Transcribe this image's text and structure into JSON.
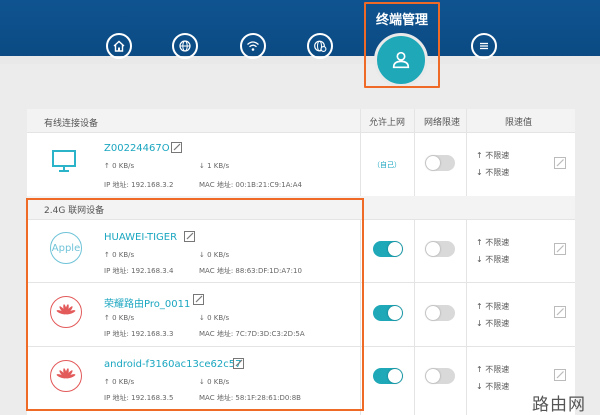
{
  "nav": {
    "active_label": "终端管理",
    "icons": [
      "home-icon",
      "globe-icon",
      "wifi-icon",
      "globe-settings-icon",
      "user-icon",
      "menu-icon"
    ]
  },
  "columns": {
    "allow_internet": "允许上网",
    "speed_limit": "网络限速",
    "limit_value": "限速值"
  },
  "wired": {
    "title": "有线连接设备",
    "devices": [
      {
        "name": "Z00224467O",
        "up": "0 KB/s",
        "down": "1 KB/s",
        "ip_label": "IP 地址:",
        "ip": "192.168.3.2",
        "mac_label": "MAC 地址:",
        "mac": "00:1B:21:C9:1A:A4",
        "self": "（自己）",
        "up_limit": "不限速",
        "down_limit": "不限速"
      }
    ]
  },
  "wifi24": {
    "title": "2.4G 联网设备",
    "devices": [
      {
        "name": "HUAWEI-TIGER",
        "icon_text": "Apple",
        "up": "0 KB/s",
        "down": "0 KB/s",
        "ip_label": "IP 地址:",
        "ip": "192.168.3.4",
        "mac_label": "MAC 地址:",
        "mac": "88:63:DF:1D:A7:10",
        "up_limit": "不限速",
        "down_limit": "不限速"
      },
      {
        "name": "荣耀路由Pro_0011",
        "up": "0 KB/s",
        "down": "0 KB/s",
        "ip_label": "IP 地址:",
        "ip": "192.168.3.3",
        "mac_label": "MAC 地址:",
        "mac": "7C:7D:3D:C3:2D:5A",
        "up_limit": "不限速",
        "down_limit": "不限速"
      },
      {
        "name": "android-f3160ac13ce62c57",
        "up": "0 KB/s",
        "down": "0 KB/s",
        "ip_label": "IP 地址:",
        "ip": "192.168.3.5",
        "mac_label": "MAC 地址:",
        "mac": "58:1F:28:61:D0:8B",
        "up_limit": "不限速",
        "down_limit": "不限速"
      }
    ]
  },
  "watermark": "路由网",
  "colors": {
    "header": "#0f5390",
    "accent": "#1ea8b8",
    "highlight": "#ef6a27",
    "huawei": "#e35a5a"
  }
}
